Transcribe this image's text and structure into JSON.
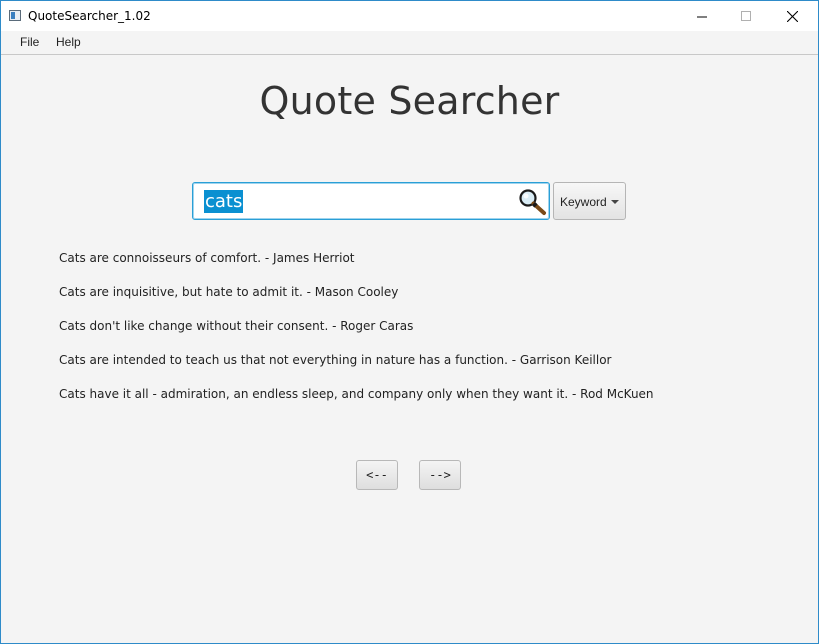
{
  "window": {
    "title": "QuoteSearcher_1.02"
  },
  "menu": {
    "file": "File",
    "help": "Help"
  },
  "main": {
    "title": "Quote Searcher",
    "search": {
      "value": "cats",
      "search_icon": "magnifier-icon"
    },
    "search_mode": {
      "selected": "Keyword"
    },
    "results": [
      "Cats are connoisseurs of comfort. - James Herriot",
      "Cats are inquisitive, but hate to admit it. - Mason Cooley",
      "Cats don't like change without their consent. - Roger Caras",
      "Cats are intended to teach us that not everything in nature has a function. - Garrison Keillor",
      "Cats have it all - admiration, an endless sleep, and company only when they want it. - Rod McKuen"
    ],
    "pagination": {
      "prev_label": "<--",
      "next_label": "-->"
    }
  },
  "colors": {
    "accent": "#0a90d1",
    "window_border": "#2e8bc9",
    "background": "#f4f4f4"
  }
}
